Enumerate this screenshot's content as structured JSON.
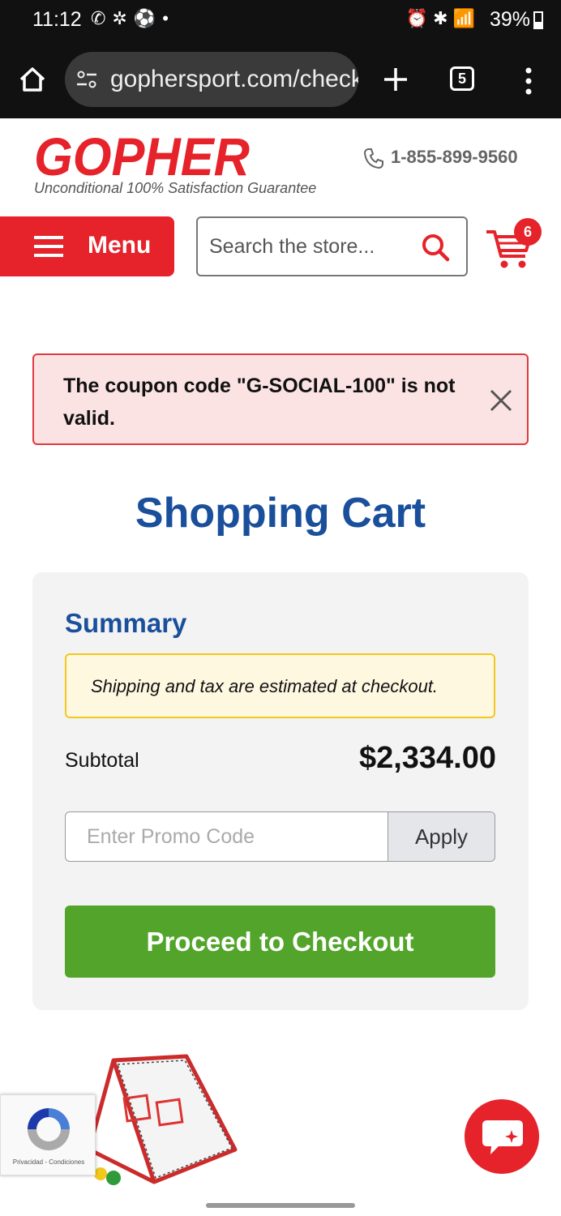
{
  "status_bar": {
    "time": "11:12",
    "battery": "39%"
  },
  "browser": {
    "url": "gophersport.com/checkout",
    "tab_count": "5"
  },
  "header": {
    "logo_text": "GOPHER",
    "tagline": "Unconditional 100% Satisfaction Guarantee",
    "phone": "1-855-899-9560",
    "menu_label": "Menu",
    "search_placeholder": "Search the store...",
    "cart_count": "6"
  },
  "alert": {
    "message": "The coupon code \"G-SOCIAL-100\" is not valid."
  },
  "page_title": "Shopping Cart",
  "summary": {
    "title": "Summary",
    "notice": "Shipping and tax are estimated at checkout.",
    "subtotal_label": "Subtotal",
    "subtotal_value": "$2,334.00",
    "promo_placeholder": "Enter Promo Code",
    "apply_label": "Apply",
    "checkout_label": "Proceed to Checkout"
  },
  "recaptcha": {
    "links": "Privacidad - Condiciones"
  },
  "colors": {
    "brand_red": "#e6222a",
    "brand_blue": "#1a4f9c",
    "checkout_green": "#52a52a",
    "notice_yellow": "#f2c81c"
  }
}
